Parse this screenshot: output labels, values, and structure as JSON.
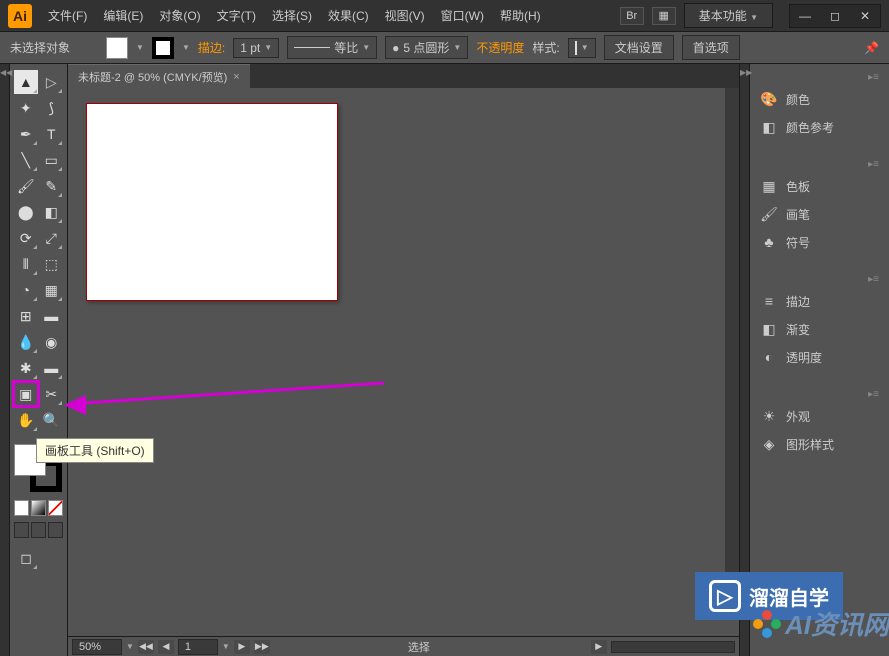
{
  "app": {
    "logo_text": "Ai"
  },
  "menu": {
    "file": "文件(F)",
    "edit": "编辑(E)",
    "object": "对象(O)",
    "type": "文字(T)",
    "select": "选择(S)",
    "effect": "效果(C)",
    "view": "视图(V)",
    "window": "窗口(W)",
    "help": "帮助(H)"
  },
  "titlebar": {
    "workspace": "基本功能"
  },
  "options": {
    "no_selection": "未选择对象",
    "stroke_label": "描边:",
    "stroke_weight": "1 pt",
    "profile_label": "等比",
    "brush_label": "5 点圆形",
    "opacity_label": "不透明度",
    "style_label": "样式:",
    "doc_setup": "文档设置",
    "preferences": "首选项"
  },
  "document": {
    "tab_title": "未标题-2 @ 50% (CMYK/预览)"
  },
  "status": {
    "zoom": "50%",
    "page": "1",
    "mode": "选择"
  },
  "tooltip": {
    "text": "画板工具 (Shift+O)"
  },
  "panels": {
    "color": "颜色",
    "color_guide": "颜色参考",
    "swatches": "色板",
    "brushes": "画笔",
    "symbols": "符号",
    "stroke": "描边",
    "gradient": "渐变",
    "transparency": "透明度",
    "appearance": "外观",
    "graphic_styles": "图形样式"
  },
  "watermark": {
    "text1": "溜溜自学",
    "text2": "AI资讯网"
  }
}
